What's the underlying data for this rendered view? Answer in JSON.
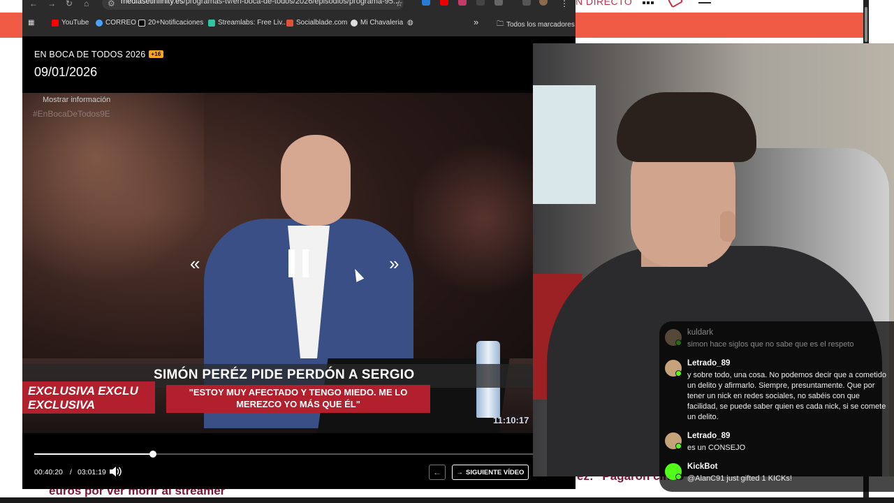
{
  "browser": {
    "url_host": "mediasetinfinity.es",
    "url_path": "/programas-tv/en-boca-de-todos/2026/episodios/programa-95...",
    "bookmarks": [
      {
        "label": "YouTube",
        "color": "#ff0000"
      },
      {
        "label": "CORREO",
        "color": "#4aa3ff"
      },
      {
        "label": "20+Notificaciones",
        "color": "#ffffff"
      },
      {
        "label": "Streamlabs: Free Liv...",
        "color": "#31c3a2"
      },
      {
        "label": "Socialblade.com",
        "color": "#e0533a"
      },
      {
        "label": "Mi Chavaleria",
        "color": "#dddddd"
      }
    ],
    "more_label": "»",
    "all_bookmarks": "Todos los marcadores"
  },
  "site": {
    "directo": "N DIRECTO",
    "headline_bottom": "euros por ver morir al streamer",
    "headline_right": "ez: \"Pagaron cinco"
  },
  "player": {
    "show_title": "EN BOCA DE TODOS 2026",
    "age_badge": "+16",
    "date": "09/01/2026",
    "mostrar": "Mostrar información",
    "hashtag": "#EnBocaDeTodos9E",
    "prev_symbol": "«",
    "next_symbol": "»",
    "lower_headline": "SIMÓN PERÉZ PIDE PERDÓN A SERGIO",
    "exclusiva_1": "EXCLUSIVA   EXCLU",
    "exclusiva_2": "EXCLUSIVA",
    "quote": "\"ESTOY MUY AFECTADO Y TENGO MIEDO. ME LO MEREZCO YO MÁS QUE ÉL\"",
    "clock": "11:10:17",
    "time_current": "00:40:20",
    "time_sep": "/",
    "time_total": "03:01:19",
    "progress_fraction": 0.2385,
    "back_symbol": "←",
    "next_video_label": "SIGUIENTE VÍDEO",
    "next_video_arrow": "→"
  },
  "chat": {
    "messages": [
      {
        "user": "kuldark",
        "text": "simon hace siglos que no sabe que es el respeto",
        "faded": true
      },
      {
        "user": "Letrado_89",
        "text": "y sobre todo, una cosa. No podemos decir que a cometido un delito y afirmarlo. Siempre, presuntamente. Que por tener un nick en redes sociales, no sabéis con que facilidad, se puede saber quien es cada nick, si se comete un delito."
      },
      {
        "user": "Letrado_89",
        "text": "es un CONSEJO"
      },
      {
        "user": "KickBot",
        "text": "@AlanC91 just gifted 1 KICKs!"
      }
    ]
  }
}
